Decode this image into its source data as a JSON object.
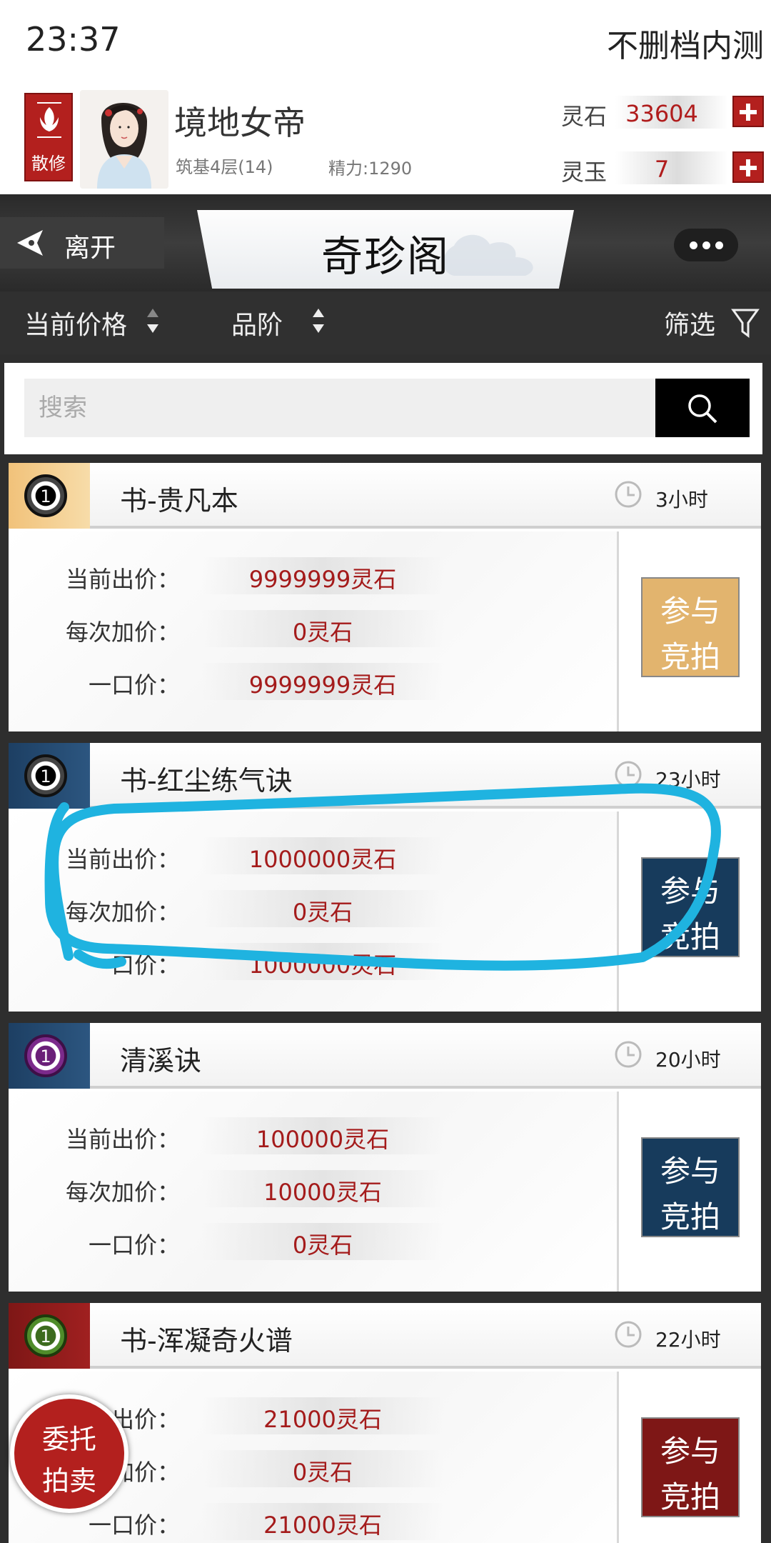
{
  "status": {
    "time": "23:37",
    "title": "不删档内测"
  },
  "player": {
    "sect_label": "散修",
    "name": "境地女帝",
    "realm": "筑基4层(14)",
    "energy": "精力:1290"
  },
  "currency": {
    "stone_label": "灵石",
    "stone_value": "33604",
    "jade_label": "灵玉",
    "jade_value": "7"
  },
  "header": {
    "back_label": "离开",
    "title": "奇珍阁"
  },
  "sort": {
    "price_label": "当前价格",
    "grade_label": "品阶",
    "filter_label": "筛选"
  },
  "search": {
    "placeholder": "搜索"
  },
  "labels": {
    "current_bid": "当前出价：",
    "increment": "每次加价：",
    "buyout": "一口价："
  },
  "items": [
    {
      "grade": "1",
      "name": "书-贵凡本",
      "time": "3小时",
      "current": "9999999灵石",
      "increment": "0灵石",
      "buyout": "9999999灵石",
      "btn1": "参与",
      "btn2": "竞拍",
      "accent": "#f1c27a",
      "ring": "#777777",
      "btn_color": "#e2b46e"
    },
    {
      "grade": "1",
      "name": "书-红尘练气诀",
      "time": "23小时",
      "current": "1000000灵石",
      "increment": "0灵石",
      "buyout": "1000000灵石",
      "btn1": "参与",
      "btn2": "竞拍",
      "accent": "#1d3f63",
      "ring": "#777777",
      "btn_color": "#173b5c"
    },
    {
      "grade": "1",
      "name": "清溪诀",
      "time": "20小时",
      "current": "100000灵石",
      "increment": "10000灵石",
      "buyout": "0灵石",
      "btn1": "参与",
      "btn2": "竞拍",
      "accent": "#1d3f63",
      "ring": "#7b2a8b",
      "btn_color": "#173b5c"
    },
    {
      "grade": "1",
      "name": "书-浑凝奇火谱",
      "time": "22小时",
      "current": "21000灵石",
      "increment": "0灵石",
      "buyout": "21000灵石",
      "btn1": "参与",
      "btn2": "竞拍",
      "accent": "#7e1716",
      "ring": "#4f8c2a",
      "btn_color": "#7e1716"
    }
  ],
  "consign": {
    "line1": "委托",
    "line2": "拍卖"
  }
}
